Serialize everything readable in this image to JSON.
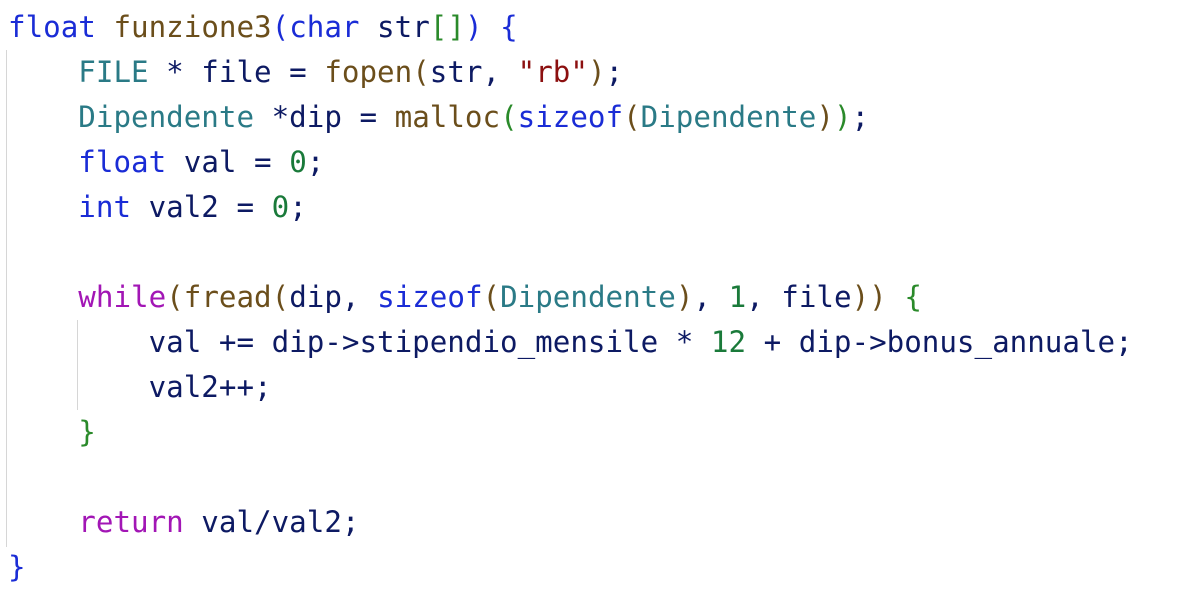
{
  "colors": {
    "keyword": "#1a2cd6",
    "function": "#6b4e1b",
    "type": "#2a7a86",
    "identifier": "#0d1a63",
    "string": "#8c1010",
    "number": "#1a7a3a",
    "control": "#a216b5",
    "paren_level1": "#1a2cd6",
    "paren_level2": "#2a8a2a",
    "paren_level3": "#6b4e1b",
    "brace_outer": "#1a2cd6",
    "brace_inner": "#2a8a2a",
    "guide": "#d6d6d6"
  },
  "code": {
    "lines": [
      [
        {
          "t": "float",
          "c": "keyword"
        },
        {
          "t": " ",
          "c": "identifier"
        },
        {
          "t": "funzione3",
          "c": "function"
        },
        {
          "t": "(",
          "c": "paren_level1"
        },
        {
          "t": "char",
          "c": "keyword"
        },
        {
          "t": " str",
          "c": "identifier"
        },
        {
          "t": "[]",
          "c": "paren_level2"
        },
        {
          "t": ")",
          "c": "paren_level1"
        },
        {
          "t": " ",
          "c": "identifier"
        },
        {
          "t": "{",
          "c": "brace_outer"
        }
      ],
      [
        {
          "t": "    ",
          "c": "identifier"
        },
        {
          "t": "FILE",
          "c": "type"
        },
        {
          "t": " * file = ",
          "c": "identifier"
        },
        {
          "t": "fopen",
          "c": "function"
        },
        {
          "t": "(",
          "c": "paren_level3"
        },
        {
          "t": "str, ",
          "c": "identifier"
        },
        {
          "t": "\"rb\"",
          "c": "string"
        },
        {
          "t": ")",
          "c": "paren_level3"
        },
        {
          "t": ";",
          "c": "identifier"
        }
      ],
      [
        {
          "t": "    ",
          "c": "identifier"
        },
        {
          "t": "Dipendente",
          "c": "type"
        },
        {
          "t": " *dip = ",
          "c": "identifier"
        },
        {
          "t": "malloc",
          "c": "function"
        },
        {
          "t": "(",
          "c": "paren_level2"
        },
        {
          "t": "sizeof",
          "c": "keyword"
        },
        {
          "t": "(",
          "c": "paren_level3"
        },
        {
          "t": "Dipendente",
          "c": "type"
        },
        {
          "t": ")",
          "c": "paren_level3"
        },
        {
          "t": ")",
          "c": "paren_level2"
        },
        {
          "t": ";",
          "c": "identifier"
        }
      ],
      [
        {
          "t": "    ",
          "c": "identifier"
        },
        {
          "t": "float",
          "c": "keyword"
        },
        {
          "t": " val = ",
          "c": "identifier"
        },
        {
          "t": "0",
          "c": "number"
        },
        {
          "t": ";",
          "c": "identifier"
        }
      ],
      [
        {
          "t": "    ",
          "c": "identifier"
        },
        {
          "t": "int",
          "c": "keyword"
        },
        {
          "t": " val2 = ",
          "c": "identifier"
        },
        {
          "t": "0",
          "c": "number"
        },
        {
          "t": ";",
          "c": "identifier"
        }
      ],
      [],
      [
        {
          "t": "    ",
          "c": "identifier"
        },
        {
          "t": "while",
          "c": "control"
        },
        {
          "t": "(",
          "c": "paren_level3"
        },
        {
          "t": "fread",
          "c": "function"
        },
        {
          "t": "(",
          "c": "paren_level3"
        },
        {
          "t": "dip, ",
          "c": "identifier"
        },
        {
          "t": "sizeof",
          "c": "keyword"
        },
        {
          "t": "(",
          "c": "paren_level3"
        },
        {
          "t": "Dipendente",
          "c": "type"
        },
        {
          "t": ")",
          "c": "paren_level3"
        },
        {
          "t": ", ",
          "c": "identifier"
        },
        {
          "t": "1",
          "c": "number"
        },
        {
          "t": ", file",
          "c": "identifier"
        },
        {
          "t": "))",
          "c": "paren_level3"
        },
        {
          "t": " ",
          "c": "identifier"
        },
        {
          "t": "{",
          "c": "brace_inner"
        }
      ],
      [
        {
          "t": "        val += dip->stipendio_mensile * ",
          "c": "identifier"
        },
        {
          "t": "12",
          "c": "number"
        },
        {
          "t": " + dip->bonus_annuale;",
          "c": "identifier"
        }
      ],
      [
        {
          "t": "        val2++;",
          "c": "identifier"
        }
      ],
      [
        {
          "t": "    ",
          "c": "identifier"
        },
        {
          "t": "}",
          "c": "brace_inner"
        }
      ],
      [],
      [
        {
          "t": "    ",
          "c": "identifier"
        },
        {
          "t": "return",
          "c": "control"
        },
        {
          "t": " val/val2;",
          "c": "identifier"
        }
      ],
      [
        {
          "t": "}",
          "c": "brace_outer"
        }
      ]
    ]
  }
}
